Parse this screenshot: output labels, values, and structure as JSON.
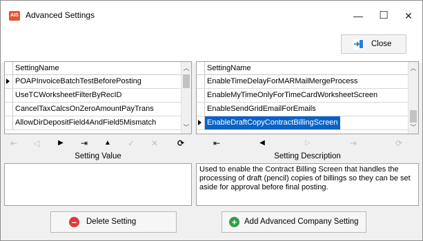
{
  "window": {
    "title": "Advanced Settings",
    "icon_text": "AIS",
    "minimize": "—",
    "maximize": "☐",
    "close": "✕"
  },
  "toolbar": {
    "close_label": "Close"
  },
  "left_grid": {
    "header": "SettingName",
    "rows": [
      "POAPInvoiceBatchTestBeforePosting",
      "UseTCWorksheetFilterByRecID",
      "CancelTaxCalcsOnZeroAmountPayTrans",
      "AllowDirDepositField4AndField5Mismatch"
    ]
  },
  "right_grid": {
    "header": "SettingName",
    "rows": [
      "EnableTimeDelayForMARMailMergeProcess",
      "EnableMyTimeOnlyForTimeCardWorksheetScreen",
      "EnableSendGridEmailForEmails",
      "EnableDraftCopyContractBillingScreen"
    ],
    "selected_index": 3
  },
  "nav_left": [
    "⇤",
    "◁",
    "▶",
    "⇥",
    "▲",
    "✓",
    "✕",
    "⟳"
  ],
  "nav_right": [
    "⇤",
    "◀",
    "▷",
    "⇥",
    "⟳"
  ],
  "setting_value": {
    "label": "Setting Value",
    "value": ""
  },
  "setting_description": {
    "label": "Setting Description",
    "text": "Used to enable the Contract Billing Screen that handles the processing of draft (pencil) copies of billings so they can be set aside for approval before final posting."
  },
  "buttons": {
    "delete_label": "Delete Setting",
    "add_label": "Add Advanced Company Setting"
  },
  "colors": {
    "selection": "#0a63c8",
    "delete_icon": "#e0393e",
    "add_icon": "#2e9e4a",
    "app_icon": "#e8542c"
  }
}
